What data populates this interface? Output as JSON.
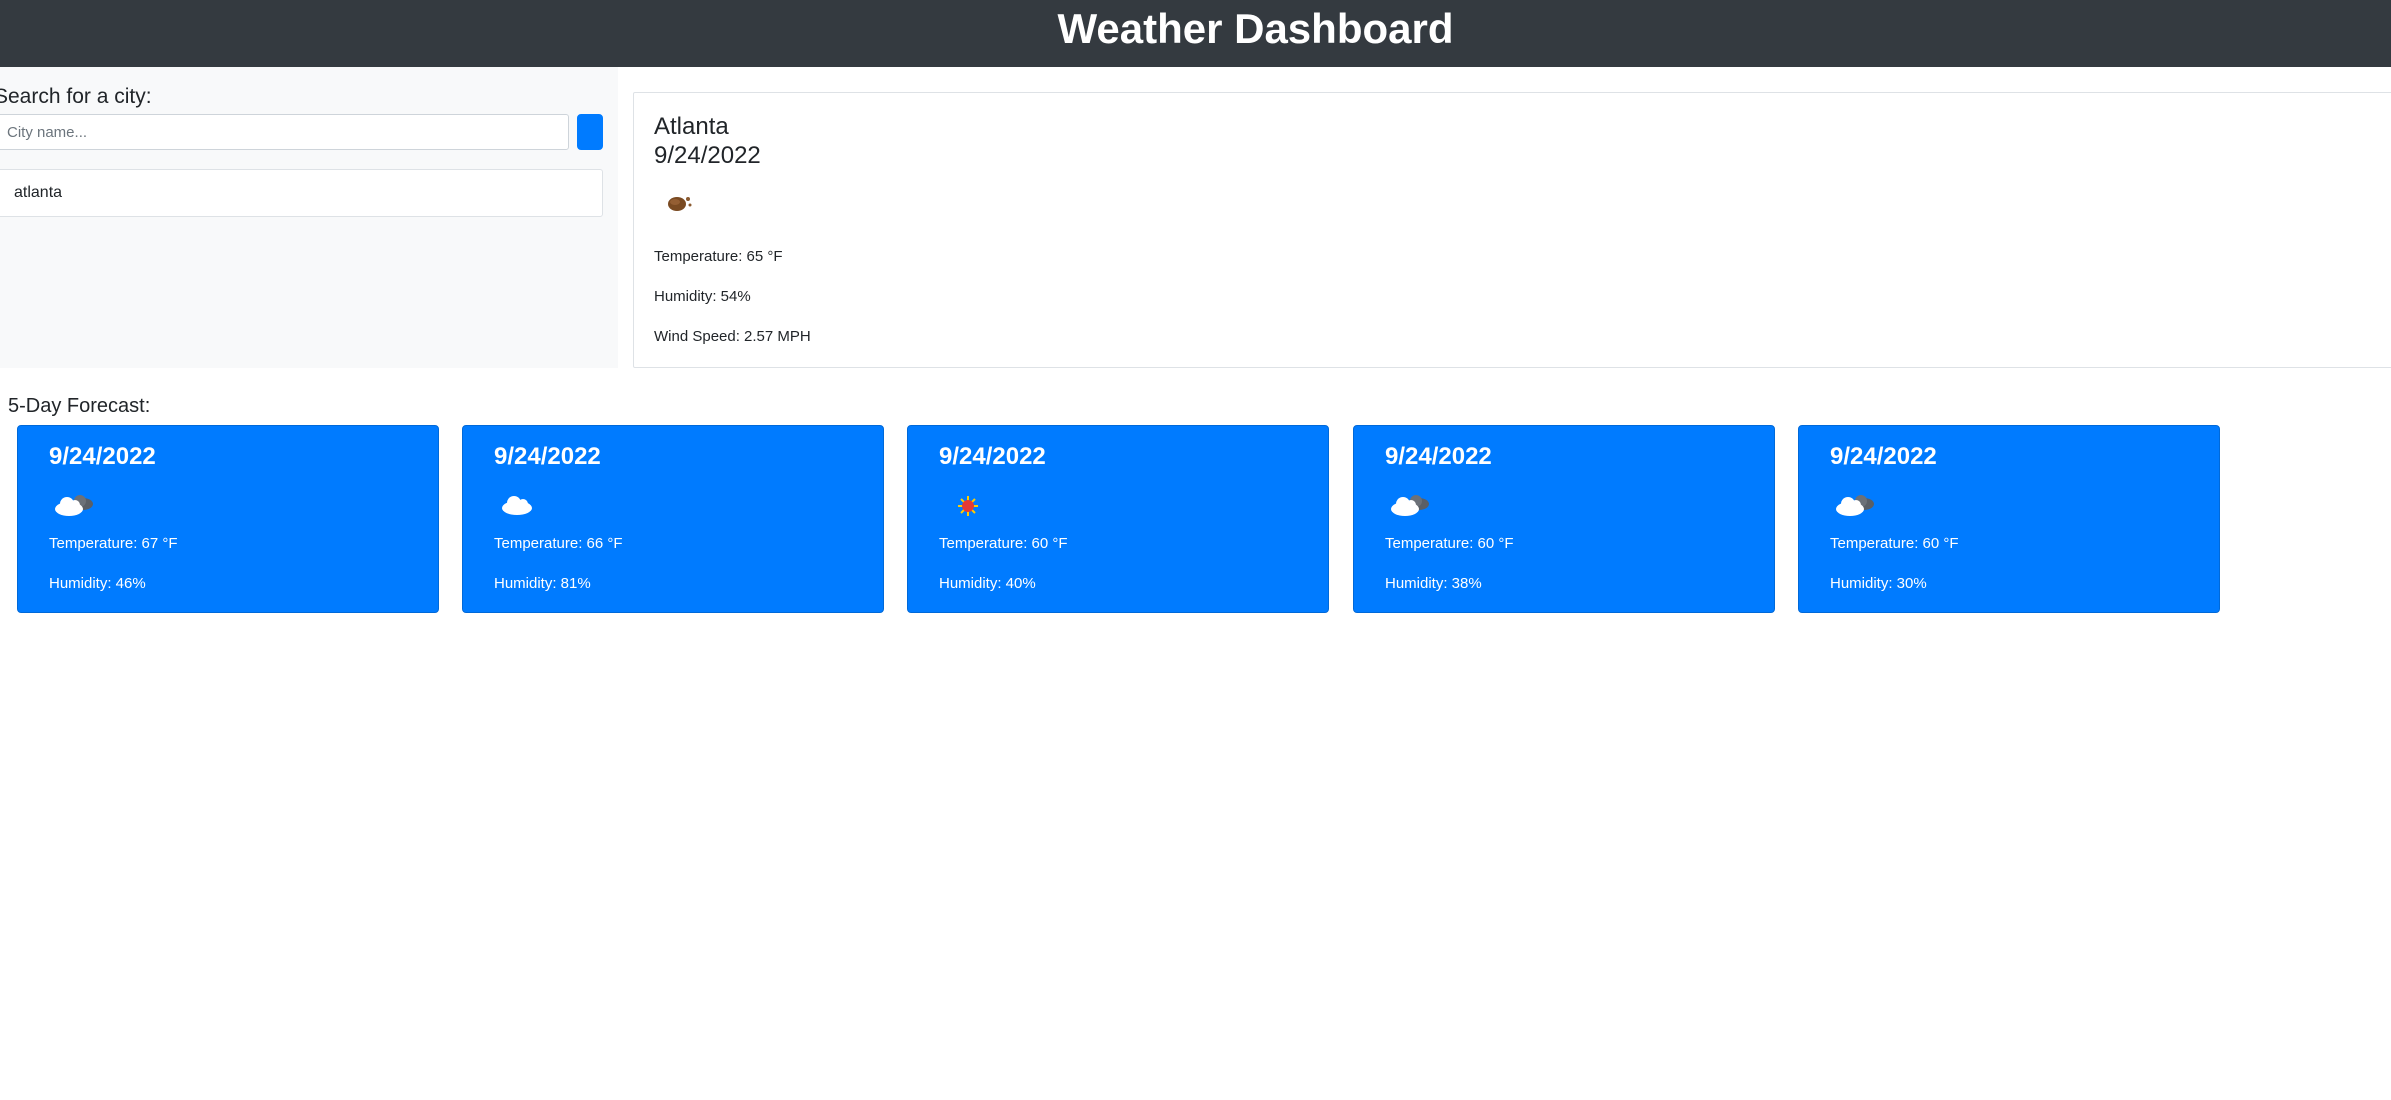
{
  "header": {
    "title": "Weather Dashboard"
  },
  "sidebar": {
    "search_label": "Search for a city:",
    "search_placeholder": "City name...",
    "search_value": "",
    "history": [
      "atlanta"
    ]
  },
  "current": {
    "city": "Atlanta",
    "date": "9/24/2022",
    "icon": "haze-icon",
    "temperature": "Temperature: 65 °F",
    "humidity": "Humidity: 54%",
    "wind": "Wind Speed: 2.57 MPH"
  },
  "forecast": {
    "heading": "5-Day Forecast:",
    "days": [
      {
        "date": "9/24/2022",
        "icon": "broken-clouds-icon",
        "temperature": "Temperature: 67 °F",
        "humidity": "Humidity: 46%"
      },
      {
        "date": "9/24/2022",
        "icon": "cloud-icon",
        "temperature": "Temperature: 66 °F",
        "humidity": "Humidity: 81%"
      },
      {
        "date": "9/24/2022",
        "icon": "sun-icon",
        "temperature": "Temperature: 60 °F",
        "humidity": "Humidity: 40%"
      },
      {
        "date": "9/24/2022",
        "icon": "broken-clouds-icon",
        "temperature": "Temperature: 60 °F",
        "humidity": "Humidity: 38%"
      },
      {
        "date": "9/24/2022",
        "icon": "broken-clouds-icon",
        "temperature": "Temperature: 60 °F",
        "humidity": "Humidity: 30%"
      }
    ]
  },
  "colors": {
    "header_bg": "#343a40",
    "sidebar_bg": "#f8f9fa",
    "accent": "#007bff"
  }
}
